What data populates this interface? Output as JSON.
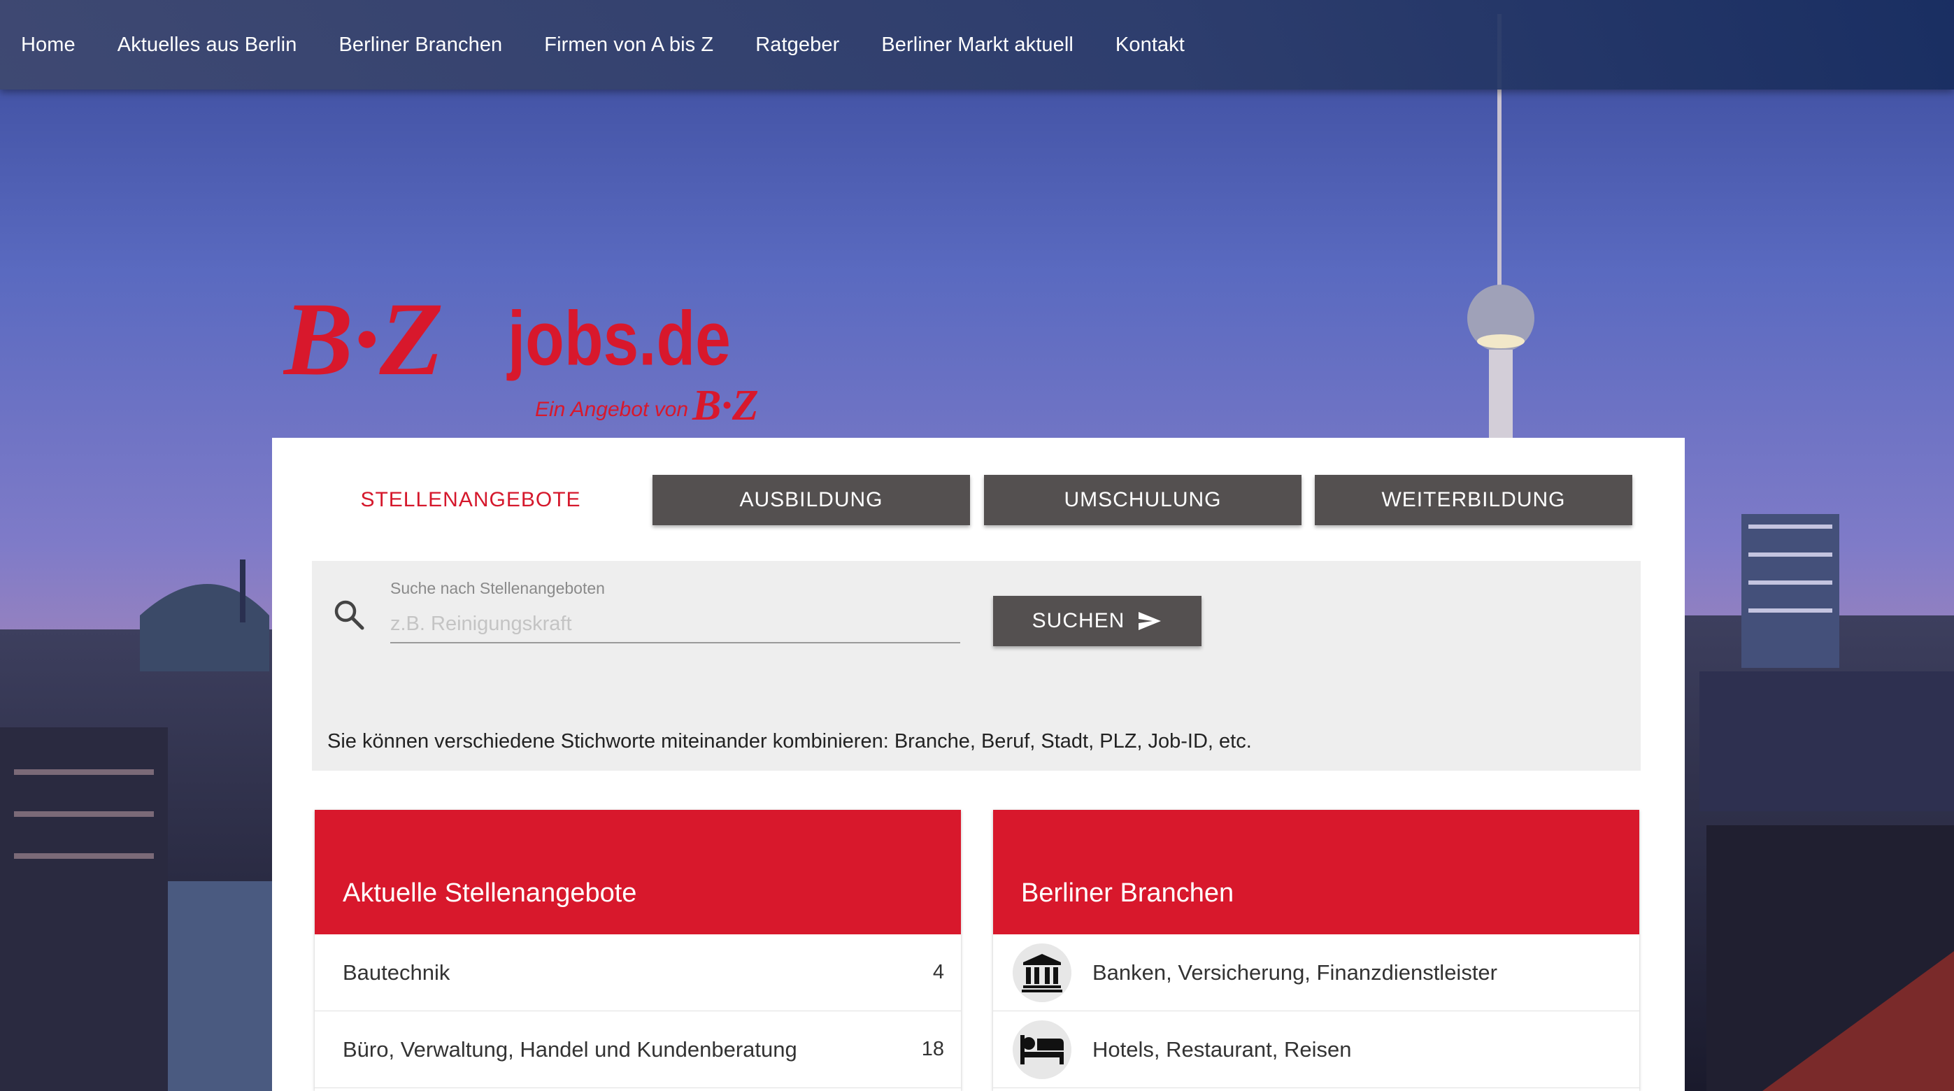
{
  "nav": {
    "items": [
      "Home",
      "Aktuelles aus Berlin",
      "Berliner Branchen",
      "Firmen von A bis Z",
      "Ratgeber",
      "Berliner Markt aktuell",
      "Kontakt"
    ]
  },
  "logo": {
    "brand": "B·Z",
    "site": "jobs.de",
    "tagline": "Ein Angebot von"
  },
  "tabs": [
    "STELLENANGEBOTE",
    "AUSBILDUNG",
    "UMSCHULUNG",
    "WEITERBILDUNG"
  ],
  "search": {
    "label": "Suche nach Stellenangeboten",
    "placeholder": "z.B. Reinigungskraft",
    "value": "",
    "button": "SUCHEN",
    "hint": "Sie können verschiedene Stichworte miteinander kombinieren: Branche, Beruf, Stadt, PLZ, Job-ID, etc."
  },
  "jobs_panel": {
    "title": "Aktuelle Stellenangebote",
    "rows": [
      {
        "label": "Bautechnik",
        "count": "4"
      },
      {
        "label": "Büro, Verwaltung, Handel und Kundenberatung",
        "count": "18"
      }
    ]
  },
  "branches_panel": {
    "title": "Berliner Branchen",
    "rows": [
      {
        "icon": "bank-icon",
        "label": "Banken, Versicherung, Finanzdienstleister"
      },
      {
        "icon": "bed-icon",
        "label": "Hotels, Restaurant, Reisen"
      }
    ]
  },
  "colors": {
    "accent": "#d8182c",
    "button": "#545050",
    "nav": "#2c3c69"
  }
}
